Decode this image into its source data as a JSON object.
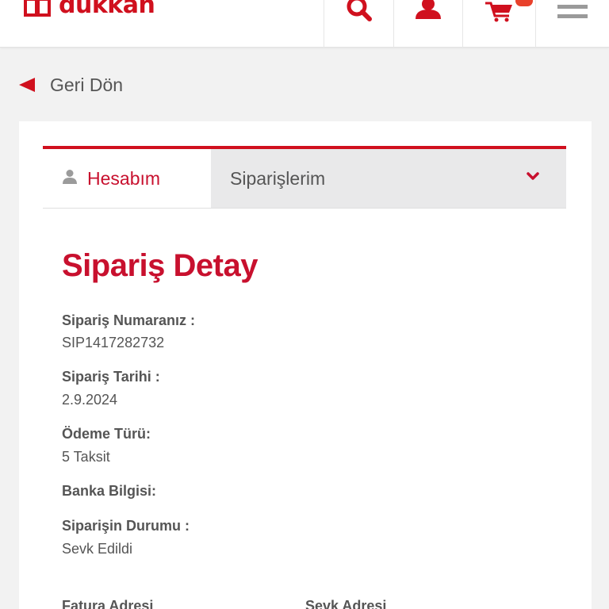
{
  "header": {
    "logo_text": "dukkan",
    "brand_color": "#d0101e",
    "icons": [
      "search-icon",
      "user-icon",
      "cart-icon",
      "menu-icon"
    ]
  },
  "back": {
    "label": "Geri Dön"
  },
  "tabs": {
    "account_label": "Hesabım",
    "orders_label": "Siparişlerim"
  },
  "order": {
    "title": "Sipariş Detay",
    "number_label": "Sipariş Numaranız :",
    "number_value": "SIP1417282732",
    "date_label": "Sipariş Tarihi :",
    "date_value": "2.9.2024",
    "payment_label": "Ödeme Türü:",
    "payment_value": "5 Taksit",
    "bank_label": "Banka Bilgisi:",
    "status_label": "Siparişin Durumu :",
    "status_value": "Sevk Edildi",
    "billing_label": "Fatura Adresi",
    "shipping_label": "Sevk Adresi"
  }
}
